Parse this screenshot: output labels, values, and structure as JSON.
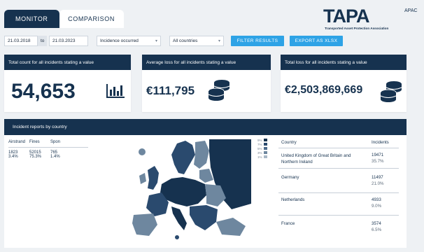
{
  "tabs": [
    {
      "label": "MONITOR",
      "active": true
    },
    {
      "label": "COMPARISON",
      "active": false
    }
  ],
  "logo": {
    "word": "TAPA",
    "sub": "APAC",
    "tagline": "Transported Asset Protection Association"
  },
  "filters": {
    "date_from": "21.03.2018",
    "to_label": "to",
    "date_to": "21.03.2023",
    "incidence": "Incidence occurred",
    "countries": "All countries",
    "filter_button": "FILTER RESULTS",
    "export_button": "EXPORT AS XLSX"
  },
  "kpis": [
    {
      "title": "Total count for all incidents stating a value",
      "value": "54,653",
      "icon": "bar-chart-icon"
    },
    {
      "title": "Average loss for all incidents stating a value",
      "value": "€111,795",
      "icon": "coin-stack-icon"
    },
    {
      "title": "Total loss for all incidents stating a value",
      "value": "€2,503,869,669",
      "icon": "coin-stack-icon"
    }
  ],
  "panel": {
    "title": "Incident reports by country"
  },
  "mini_table": {
    "headers": [
      "Airstrand",
      "Fines",
      "Spon"
    ],
    "rows": [
      [
        "1823",
        "52015",
        "765"
      ],
      [
        "3.4%",
        "75.3%",
        "1.4%"
      ]
    ]
  },
  "legend": [
    "9%",
    "7%",
    "5%",
    "3%",
    "1%"
  ],
  "country_table": {
    "headers": [
      "Country",
      "Incidents"
    ],
    "rows": [
      {
        "country": "United Kingdom of Great Britain and Northern Ireland",
        "count": "19471",
        "pct": "35.7%"
      },
      {
        "country": "Germany",
        "count": "11497",
        "pct": "21.0%"
      },
      {
        "country": "Netherlands",
        "count": "4933",
        "pct": "9.0%"
      },
      {
        "country": "France",
        "count": "3574",
        "pct": "6.5%"
      }
    ]
  },
  "colors": {
    "navy": "#16324f",
    "accent": "#2ea3e6",
    "map_mid": "#2a4a6e",
    "map_light": "#6e879f"
  }
}
